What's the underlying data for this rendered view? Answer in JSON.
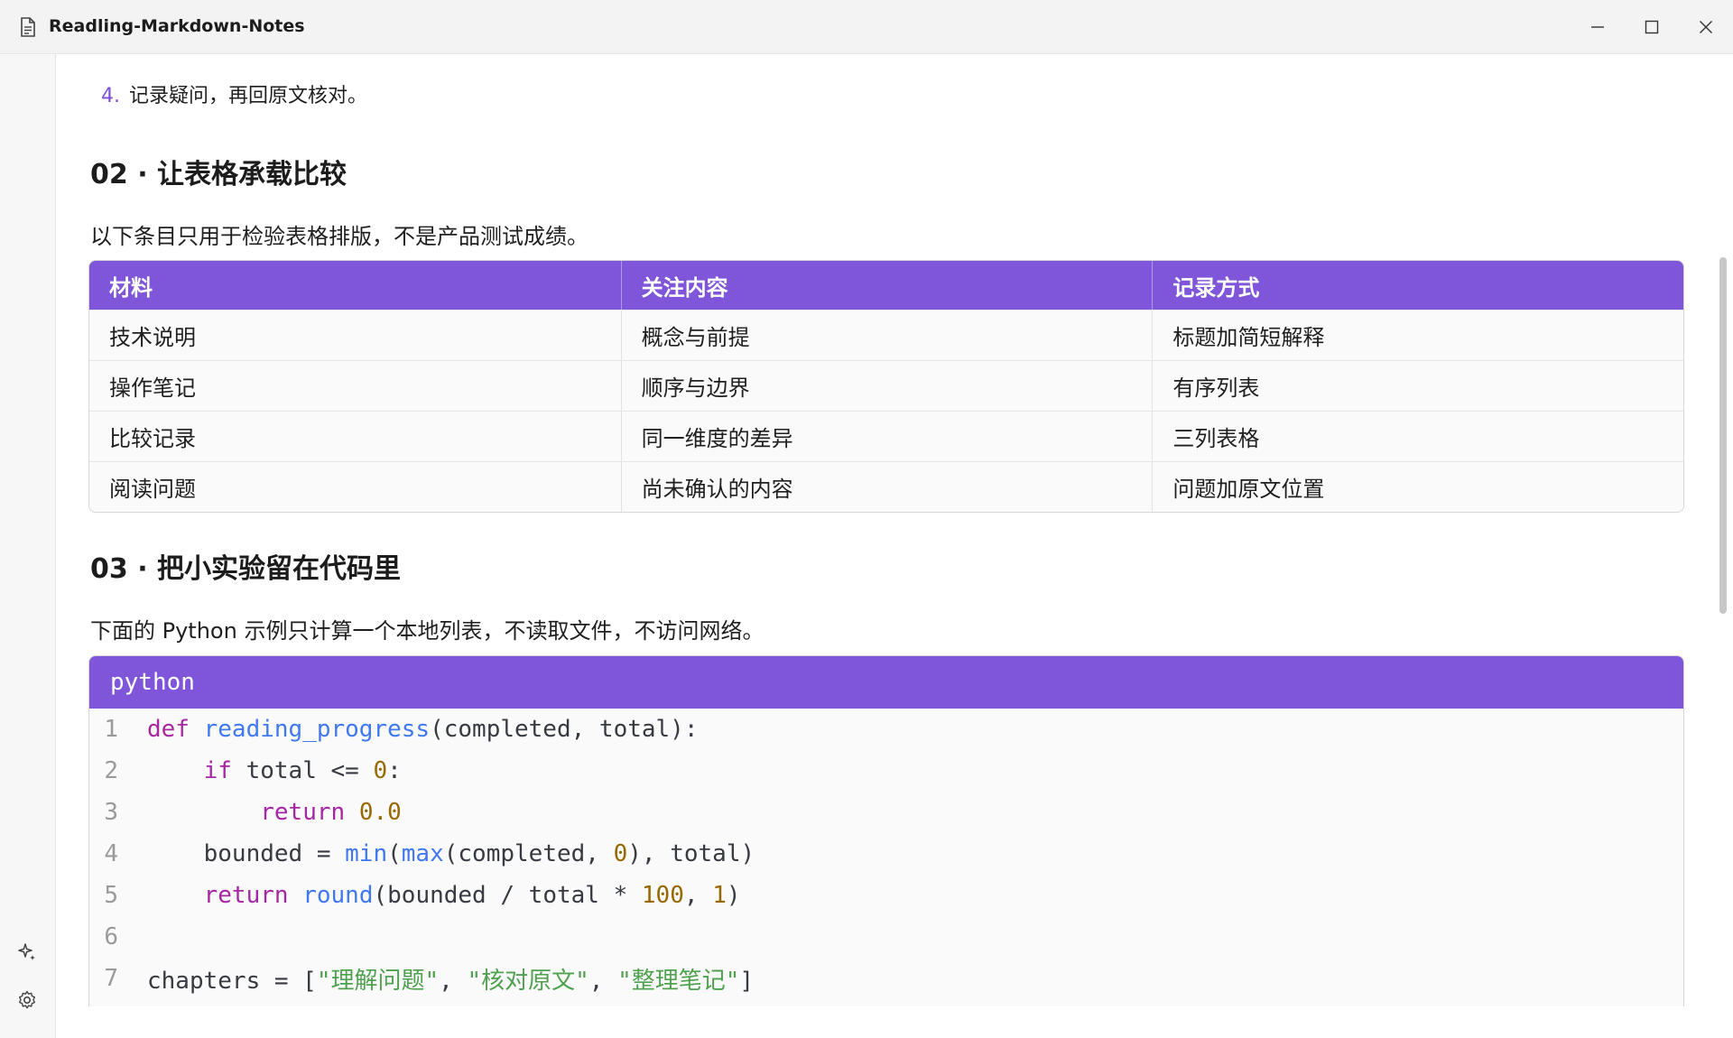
{
  "window": {
    "title": "Readling-Markdown-Notes"
  },
  "list": {
    "item_number": "4.",
    "item_text": "记录疑问，再回原文核对。"
  },
  "section2": {
    "heading": "02 · 让表格承载比较",
    "intro": "以下条目只用于检验表格排版，不是产品测试成绩。",
    "table": {
      "headers": [
        "材料",
        "关注内容",
        "记录方式"
      ],
      "rows": [
        [
          "技术说明",
          "概念与前提",
          "标题加简短解释"
        ],
        [
          "操作笔记",
          "顺序与边界",
          "有序列表"
        ],
        [
          "比较记录",
          "同一维度的差异",
          "三列表格"
        ],
        [
          "阅读问题",
          "尚未确认的内容",
          "问题加原文位置"
        ]
      ]
    }
  },
  "section3": {
    "heading": "03 · 把小实验留在代码里",
    "intro": "下面的 Python 示例只计算一个本地列表，不读取文件，不访问网络。",
    "code": {
      "language": "python",
      "line_numbers": [
        "1",
        "2",
        "3",
        "4",
        "5",
        "6",
        "7"
      ]
    }
  },
  "icons": {
    "doc": "document-icon",
    "minimize": "minimize-icon",
    "maximize": "maximize-icon",
    "close": "close-icon",
    "ai": "sparkle-icon",
    "settings": "gear-icon"
  },
  "colors": {
    "accent": "#7f56d9",
    "keyword": "#a626a4",
    "function": "#4078f2",
    "number": "#986801",
    "string": "#50a14f"
  }
}
